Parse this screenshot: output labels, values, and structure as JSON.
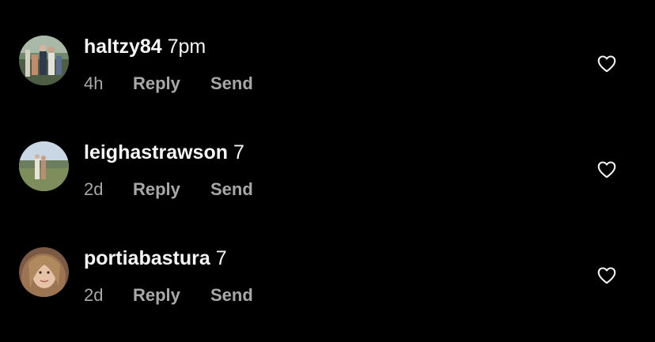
{
  "comments": [
    {
      "username": "haltzy84",
      "text": "7pm",
      "time": "4h",
      "reply_label": "Reply",
      "send_label": "Send",
      "like_icon": "heart-outline-icon"
    },
    {
      "username": "leighastrawson",
      "text": "7",
      "time": "2d",
      "reply_label": "Reply",
      "send_label": "Send",
      "like_icon": "heart-outline-icon"
    },
    {
      "username": "portiabastura",
      "text": "7",
      "time": "2d",
      "reply_label": "Reply",
      "send_label": "Send",
      "like_icon": "heart-outline-icon"
    }
  ],
  "colors": {
    "background": "#000000",
    "primary_text": "#f5f5f5",
    "secondary_text": "#a8a8a8"
  }
}
